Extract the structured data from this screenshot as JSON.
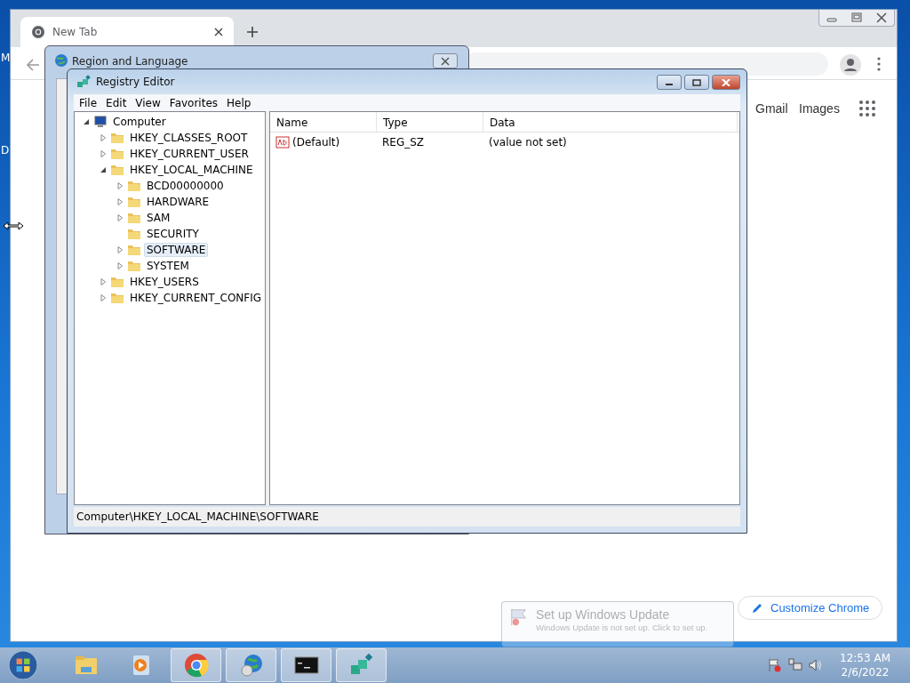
{
  "desktop": {
    "edge_labels": [
      "M",
      "D"
    ]
  },
  "browser": {
    "tab": {
      "title": "New Tab"
    },
    "links": [
      "Gmail",
      "Images"
    ],
    "customize_button": "Customize Chrome"
  },
  "region_dialog": {
    "title": "Region and Language"
  },
  "regedit": {
    "title": "Registry Editor",
    "menu": [
      "File",
      "Edit",
      "View",
      "Favorites",
      "Help"
    ],
    "tree": {
      "label": "Computer",
      "kind": "computer",
      "expanded": true,
      "selected": false,
      "children": [
        {
          "label": "HKEY_CLASSES_ROOT",
          "kind": "folder",
          "expanded": false,
          "selected": false
        },
        {
          "label": "HKEY_CURRENT_USER",
          "kind": "folder",
          "expanded": false,
          "selected": false
        },
        {
          "label": "HKEY_LOCAL_MACHINE",
          "kind": "folder",
          "expanded": true,
          "selected": false,
          "children": [
            {
              "label": "BCD00000000",
              "kind": "folder",
              "expanded": false,
              "selected": false
            },
            {
              "label": "HARDWARE",
              "kind": "folder",
              "expanded": false,
              "selected": false
            },
            {
              "label": "SAM",
              "kind": "folder",
              "expanded": false,
              "selected": false
            },
            {
              "label": "SECURITY",
              "kind": "folder",
              "selected": false
            },
            {
              "label": "SOFTWARE",
              "kind": "folder",
              "expanded": false,
              "selected": true
            },
            {
              "label": "SYSTEM",
              "kind": "folder",
              "expanded": false,
              "selected": false
            }
          ]
        },
        {
          "label": "HKEY_USERS",
          "kind": "folder",
          "expanded": false,
          "selected": false
        },
        {
          "label": "HKEY_CURRENT_CONFIG",
          "kind": "folder",
          "expanded": false,
          "selected": false
        }
      ]
    },
    "columns": [
      "Name",
      "Type",
      "Data"
    ],
    "rows": [
      {
        "name": "(Default)",
        "type": "REG_SZ",
        "data": "(value not set)"
      }
    ],
    "status_bar": "Computer\\HKEY_LOCAL_MACHINE\\SOFTWARE"
  },
  "notification": {
    "title": "Set up Windows Update",
    "message": "Windows Update is not set up. Click to set up."
  },
  "taskbar": {
    "apps": [
      {
        "kind": "explorer",
        "running": false
      },
      {
        "kind": "media",
        "running": false
      },
      {
        "kind": "chrome",
        "running": true
      },
      {
        "kind": "globe",
        "running": true
      },
      {
        "kind": "console",
        "running": true
      },
      {
        "kind": "registry",
        "running": true
      }
    ],
    "clock": {
      "time": "12:53 AM",
      "date": "2/6/2022"
    }
  }
}
